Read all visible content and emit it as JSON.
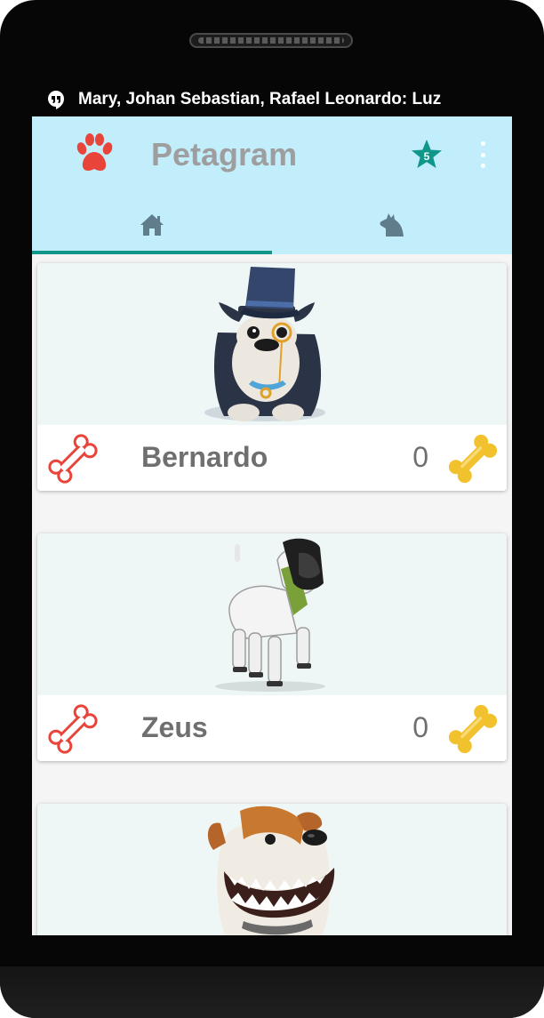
{
  "notification": {
    "icon": "hangouts-quote-icon",
    "text": "Mary, Johan Sebastian, Rafael Leonardo: Luz"
  },
  "appbar": {
    "title": "Petagram",
    "logo_icon": "paw-icon",
    "favorites_badge": "5",
    "accent_color": "#c2eefc"
  },
  "tabs": [
    {
      "icon": "home-icon",
      "selected": true
    },
    {
      "icon": "dog-profile-icon",
      "selected": false
    }
  ],
  "colors": {
    "tab_indicator": "#11978a",
    "bone_like": "#e8443a",
    "bone_rating": "#f2c12e"
  },
  "pets": [
    {
      "name": "Bernardo",
      "likes": "0",
      "image": "bulldog-top-hat"
    },
    {
      "name": "Zeus",
      "likes": "0",
      "image": "robot-dog"
    },
    {
      "name": "",
      "likes": "",
      "image": "grinning-terrier"
    }
  ]
}
